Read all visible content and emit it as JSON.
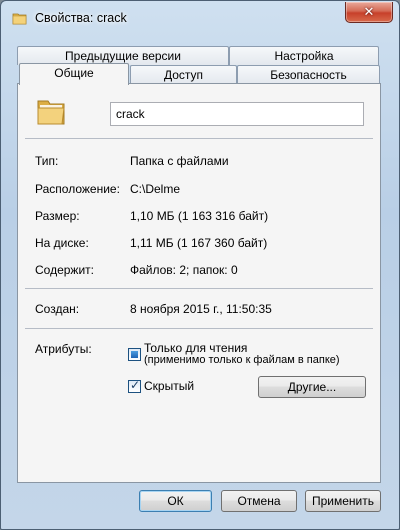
{
  "window": {
    "title": "Свойства: crack",
    "close_glyph": "✕"
  },
  "tabs_row_back": [
    {
      "label": "Предыдущие версии"
    },
    {
      "label": "Настройка"
    }
  ],
  "tabs_row_front": [
    {
      "label": "Общие",
      "active": true
    },
    {
      "label": "Доступ"
    },
    {
      "label": "Безопасность"
    }
  ],
  "general": {
    "name_value": "crack",
    "properties": [
      {
        "label": "Тип:",
        "value": "Папка с файлами"
      },
      {
        "label": "Расположение:",
        "value": "C:\\Delme"
      },
      {
        "label": "Размер:",
        "value": "1,10 МБ (1 163 316 байт)"
      },
      {
        "label": "На диске:",
        "value": "1,11 МБ (1 167 360 байт)"
      },
      {
        "label": "Содержит:",
        "value": "Файлов: 2; папок: 0"
      }
    ],
    "created_label": "Создан:",
    "created_value": "8 ноября 2015 г., 11:50:35",
    "attributes_label": "Атрибуты:",
    "readonly_label": "Только для чтения",
    "readonly_note": "(применимо только к файлам в папке)",
    "hidden_label": "Скрытый",
    "other_button": "Другие..."
  },
  "footer": {
    "ok": "ОК",
    "cancel": "Отмена",
    "apply": "Применить"
  },
  "colors": {
    "accent_blue": "#1e63b3",
    "close_red": "#c7402a",
    "panel_bg": "#f5f5f5"
  },
  "icons": {
    "title": "folder-icon",
    "folder": "folder-icon",
    "close": "close-icon"
  }
}
